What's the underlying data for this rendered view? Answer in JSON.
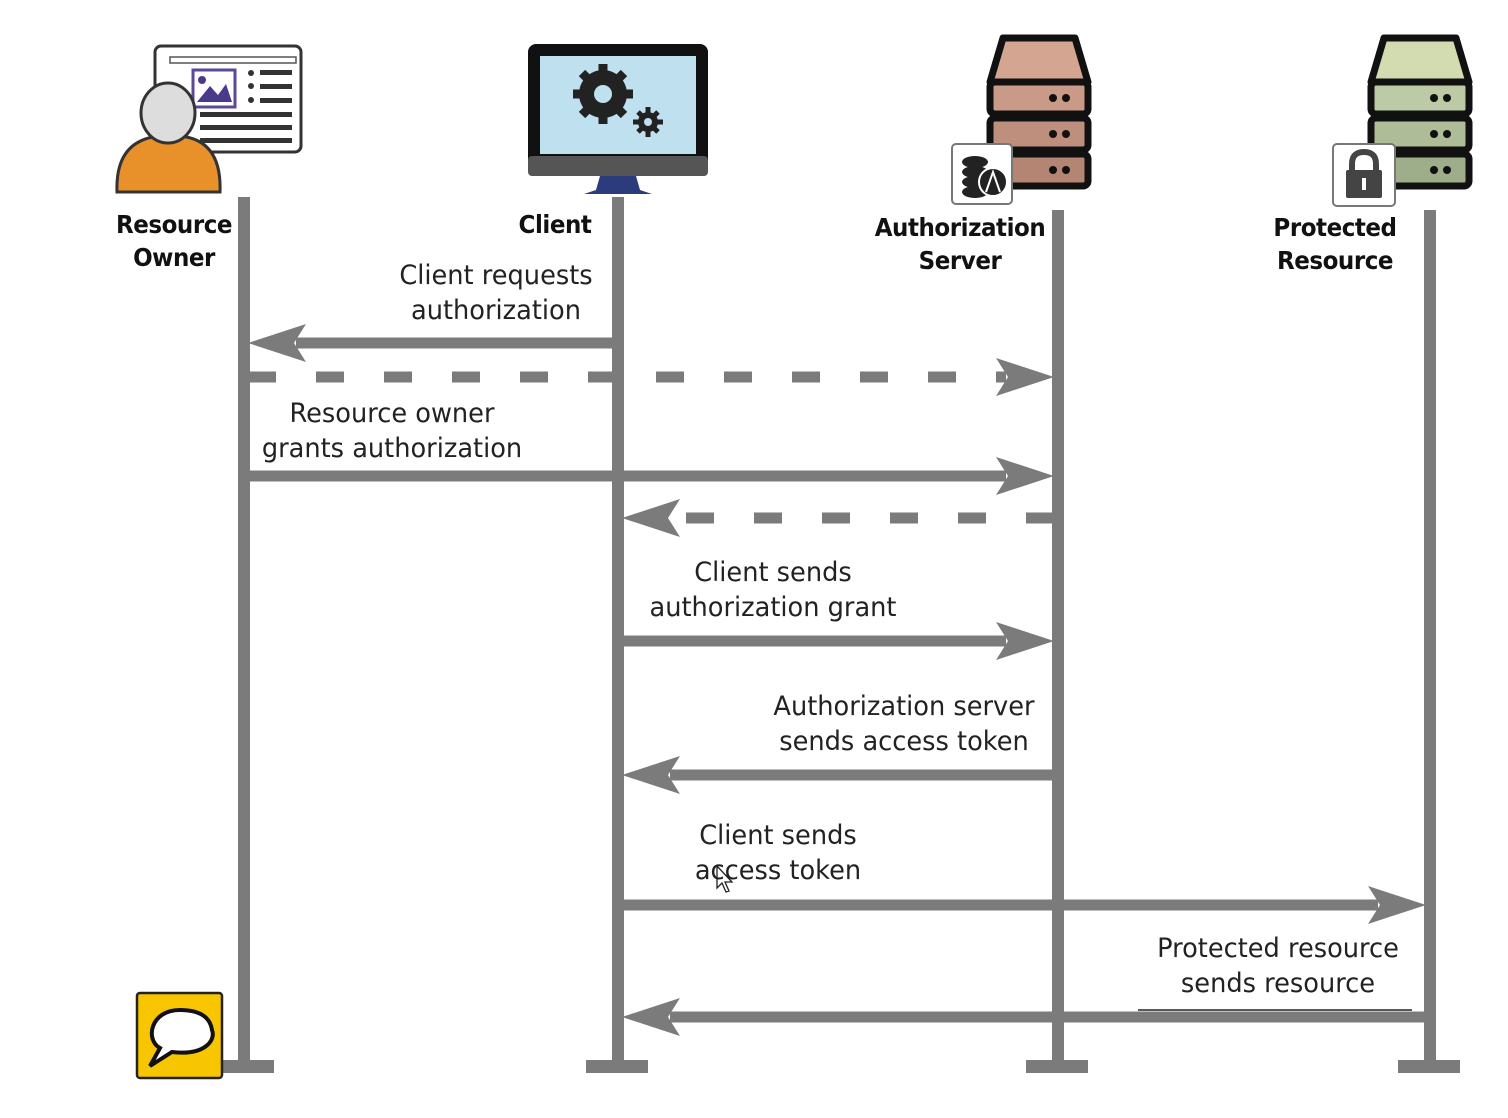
{
  "actors": [
    {
      "label_1": "Resource",
      "label_2": "Owner",
      "icon": "person-browser-icon"
    },
    {
      "label_1": "Client",
      "label_2": "",
      "icon": "monitor-gears-icon"
    },
    {
      "label_1": "Authorization",
      "label_2": "Server",
      "icon": "server-coins-icon"
    },
    {
      "label_1": "Protected",
      "label_2": "Resource",
      "icon": "server-lock-icon"
    }
  ],
  "messages": [
    {
      "from": 1,
      "to": 0,
      "style": "solid",
      "line_1": "Client requests",
      "line_2": "authorization"
    },
    {
      "from": 0,
      "to": 2,
      "style": "dashed",
      "line_1": "",
      "line_2": ""
    },
    {
      "from": 0,
      "to": 2,
      "style": "solid",
      "line_1": "Resource owner",
      "line_2": "grants authorization"
    },
    {
      "from": 2,
      "to": 1,
      "style": "dashed",
      "line_1": "",
      "line_2": ""
    },
    {
      "from": 1,
      "to": 2,
      "style": "solid",
      "line_1": "Client sends",
      "line_2": "authorization grant"
    },
    {
      "from": 2,
      "to": 1,
      "style": "solid",
      "line_1": "Authorization server",
      "line_2": "sends access token"
    },
    {
      "from": 1,
      "to": 3,
      "style": "solid",
      "line_1": "Client sends",
      "line_2": "access token"
    },
    {
      "from": 3,
      "to": 1,
      "style": "solid",
      "line_1": "Protected resource",
      "line_2": "sends resource"
    }
  ],
  "colors": {
    "line": "#7b7b7b",
    "person": "#e8902a",
    "auth_server": "#c99a88",
    "resource_server": "#b7c6a0",
    "screen": "#bfe0ef",
    "chat": "#f7c600"
  },
  "extra_icons": [
    "chat-bubble-icon",
    "mouse-cursor-icon"
  ]
}
